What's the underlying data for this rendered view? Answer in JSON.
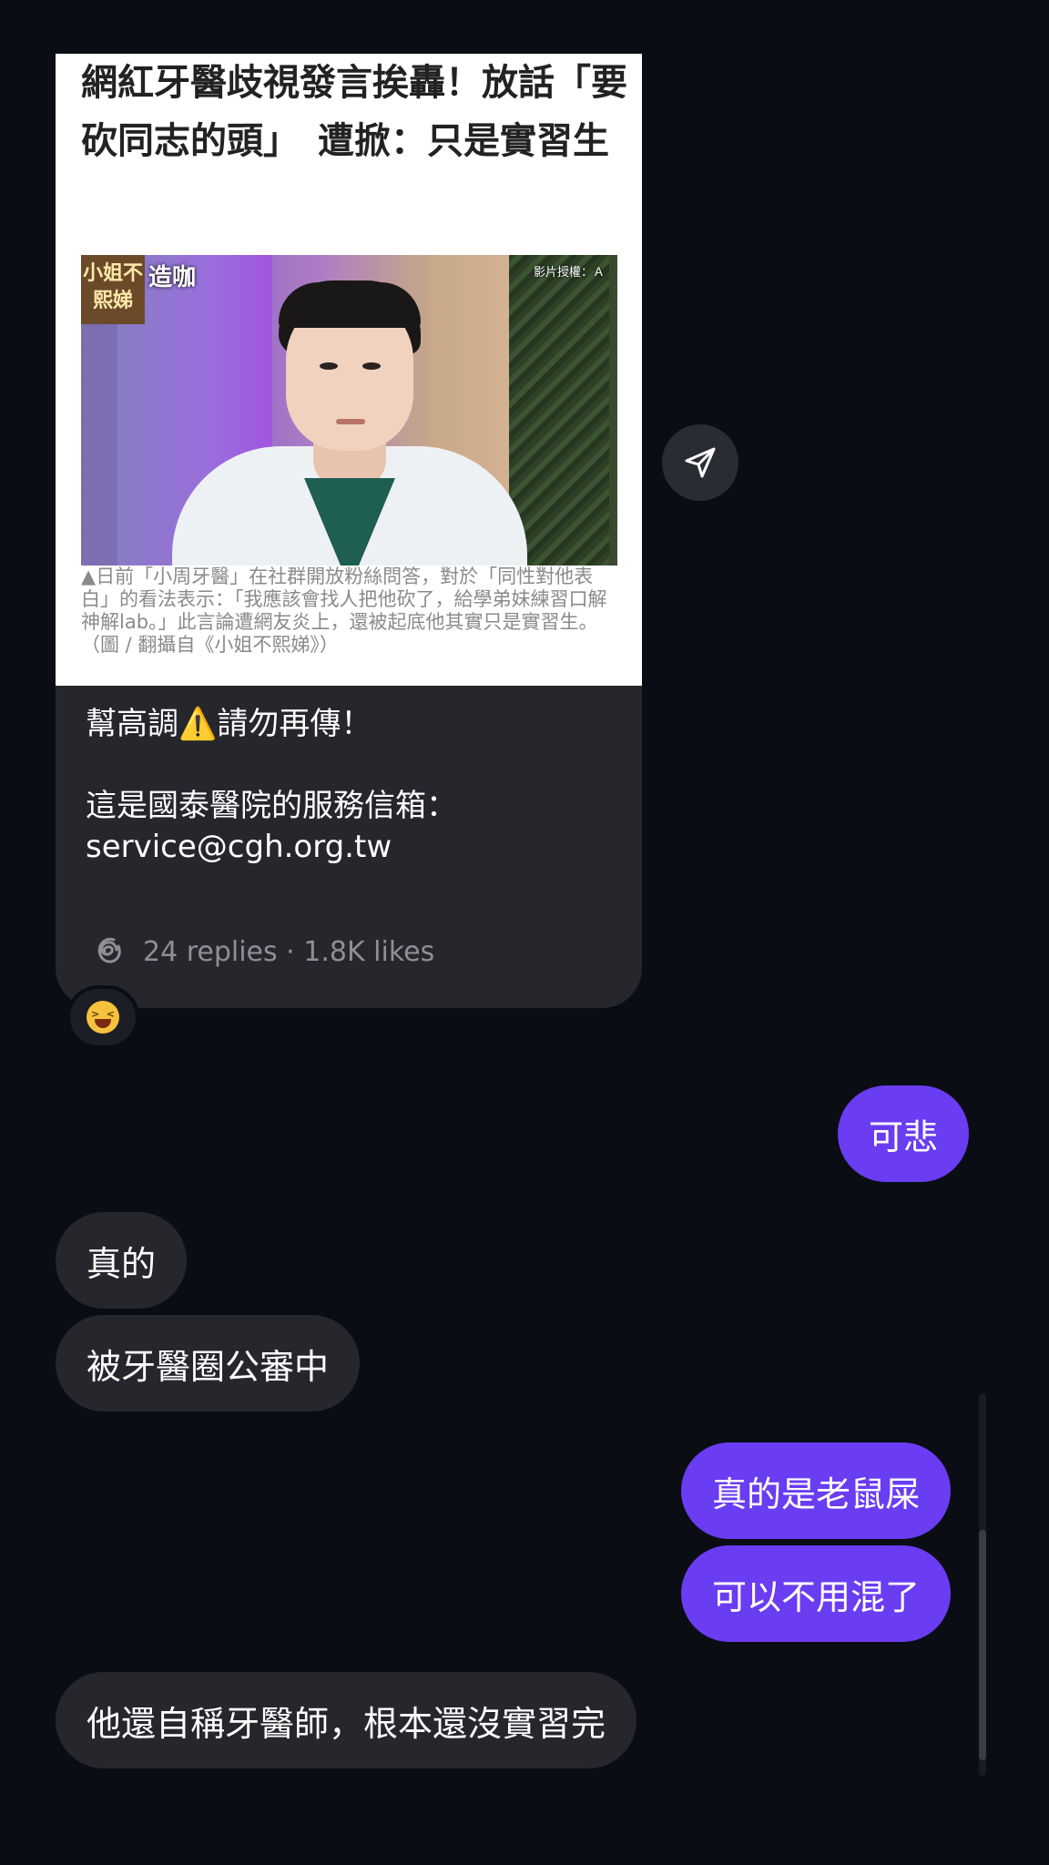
{
  "shared_post": {
    "headline": "網紅牙醫歧視發言挨轟！放話「要砍同志的頭」　遭掀：只是實習生",
    "photo": {
      "show_logo": "小姐不熙娣",
      "show_tag": "造咖",
      "credit": "影片授權：Ａ"
    },
    "caption": "▲日前「小周牙醫」在社群開放粉絲問答，對於「同性對他表白」的看法表示：「我應該會找人把他砍了，給學弟妹練習口解神解lab。」此言論遭網友炎上，還被起底他其實只是實習生。（圖 / 翻攝自《小姐不熙娣》）",
    "text_line1": "幫高調⚠️請勿再傳！",
    "text_line2": "這是國泰醫院的服務信箱：",
    "text_line3": "service@cgh.org.tw",
    "stats": "24 replies · 1.8K likes",
    "reaction_emoji": "smiling-squinting-face"
  },
  "messages": [
    {
      "side": "out",
      "text": "可悲"
    },
    {
      "side": "in",
      "text": "真的"
    },
    {
      "side": "in",
      "text": "被牙醫圈公審中"
    },
    {
      "side": "out",
      "text": "真的是老鼠屎"
    },
    {
      "side": "out",
      "text": "可以不用混了"
    },
    {
      "side": "in",
      "text": "他還自稱牙醫師，根本還沒實習完"
    }
  ],
  "colors": {
    "background": "#0b0d14",
    "incoming_bubble": "#25272d",
    "outgoing_bubble": "#6a3cf2"
  }
}
